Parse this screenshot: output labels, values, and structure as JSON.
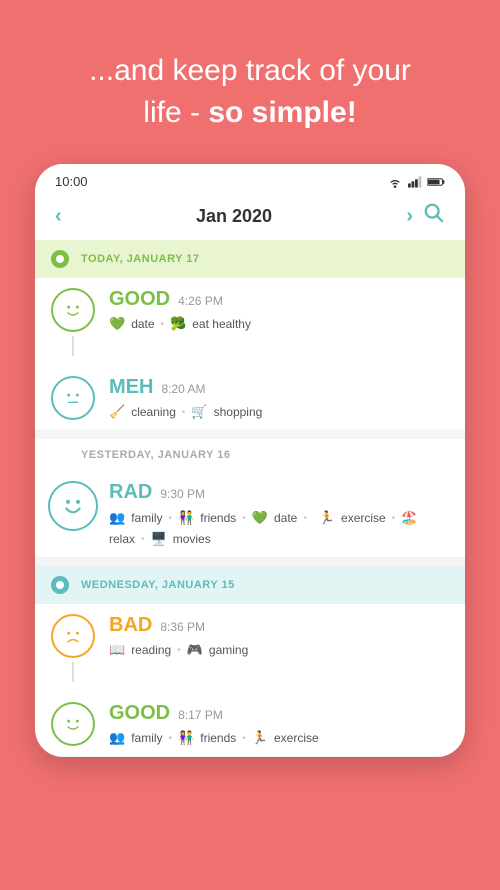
{
  "header": {
    "line1": "...and keep track of your",
    "line2": "life - ",
    "line2_bold": "so simple!"
  },
  "status_bar": {
    "time": "10:00"
  },
  "nav": {
    "month": "Jan 2020",
    "prev_label": "‹",
    "next_label": "›"
  },
  "days": [
    {
      "id": "today",
      "label": "TODAY, JANUARY 17",
      "type": "today",
      "entries": [
        {
          "mood": "GOOD",
          "mood_type": "good",
          "time": "4:26 PM",
          "tags": [
            {
              "icon": "💚",
              "text": "date"
            },
            {
              "icon": "🥦",
              "text": "eat healthy"
            }
          ],
          "face": "😊",
          "connector": true
        },
        {
          "mood": "MEH",
          "mood_type": "meh",
          "time": "8:20 AM",
          "tags": [
            {
              "icon": "🧹",
              "text": "cleaning"
            },
            {
              "icon": "🛒",
              "text": "shopping"
            }
          ],
          "face": "😐",
          "connector": false
        }
      ]
    },
    {
      "id": "yesterday",
      "label": "YESTERDAY, JANUARY 16",
      "type": "plain",
      "entries": [
        {
          "mood": "RAD",
          "mood_type": "rad",
          "time": "9:30 PM",
          "tags": [
            {
              "icon": "👥",
              "text": "family"
            },
            {
              "icon": "👫",
              "text": "friends"
            },
            {
              "icon": "💚",
              "text": "date"
            },
            {
              "icon": "🏃",
              "text": "exercise"
            },
            {
              "icon": "🏖️",
              "text": "relax"
            },
            {
              "icon": "🖥️",
              "text": "movies"
            }
          ],
          "face": "😄",
          "connector": false
        }
      ]
    },
    {
      "id": "wednesday",
      "label": "WEDNESDAY, JANUARY 15",
      "type": "wednesday",
      "entries": [
        {
          "mood": "BAD",
          "mood_type": "bad",
          "time": "8:36 PM",
          "tags": [
            {
              "icon": "📖",
              "text": "reading"
            },
            {
              "icon": "🎮",
              "text": "gaming"
            }
          ],
          "face": "😟",
          "connector": true
        },
        {
          "mood": "GOOD",
          "mood_type": "good",
          "time": "8:17 PM",
          "tags": [
            {
              "icon": "👥",
              "text": "family"
            },
            {
              "icon": "👫",
              "text": "friends"
            },
            {
              "icon": "🏃",
              "text": "exercise"
            }
          ],
          "face": "😊",
          "connector": false
        }
      ]
    }
  ]
}
